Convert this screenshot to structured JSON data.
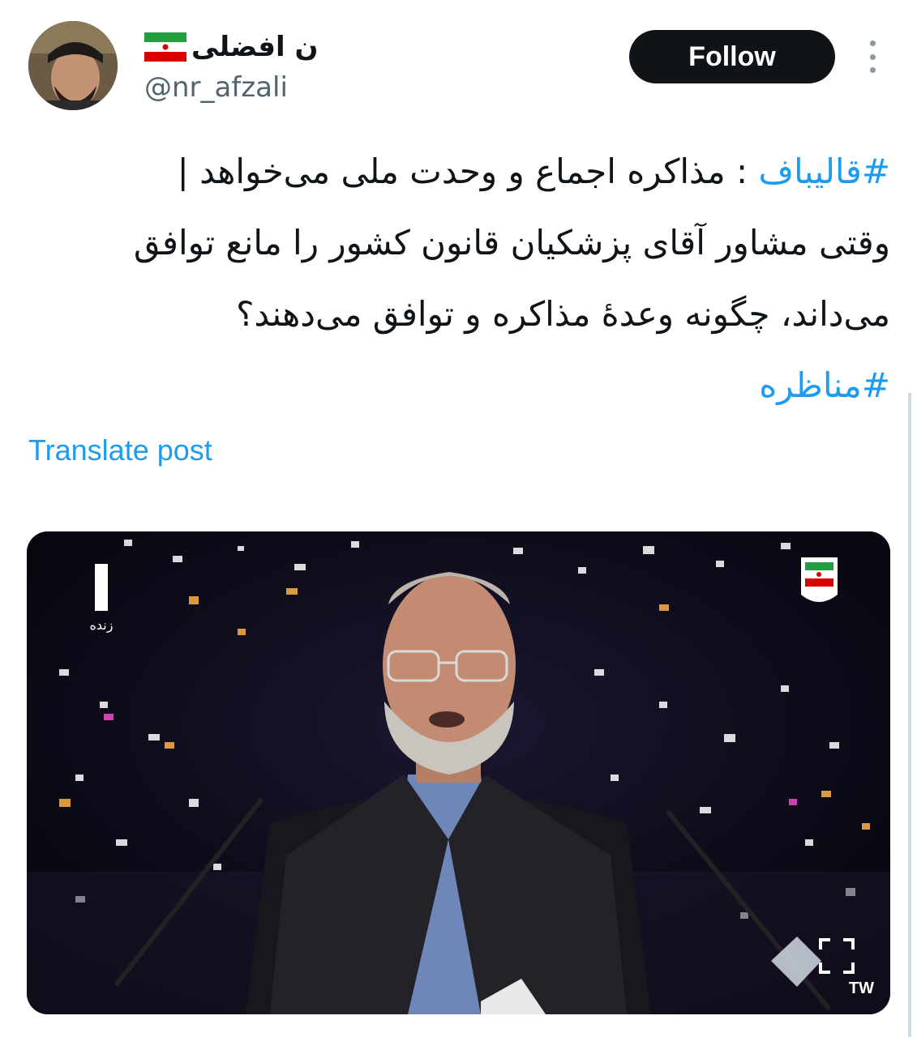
{
  "author": {
    "display_name": "ن افضلی",
    "flag_icon": "iran-flag-icon",
    "handle": "@nr_afzali",
    "avatar_icon": "profile-photo"
  },
  "follow_button": {
    "label": "Follow"
  },
  "more_icon": "vertical-ellipsis-icon",
  "tweet": {
    "line1": {
      "hashtag": "#قالیباف",
      "text": " : مذاکره اجماع و وحدت ملی می‌خواهد |"
    },
    "line2": "وقتی مشاور آقای پزشکیان قانون کشور را مانع توافق",
    "line3": "می‌داند، چگونه وعدهٔ مذاکره و توافق می‌دهند؟",
    "line4_hashtag": "#مناظره"
  },
  "translate_label": "Translate post",
  "media": {
    "live_label": "زنده",
    "fullscreen_icon": "fullscreen-icon",
    "emblem_icon": "iran-emblem-icon",
    "watermark": "TW"
  },
  "colors": {
    "link": "#1d9bf0",
    "text": "#0f1419",
    "secondary": "#536471",
    "button_bg": "#0f1419"
  }
}
